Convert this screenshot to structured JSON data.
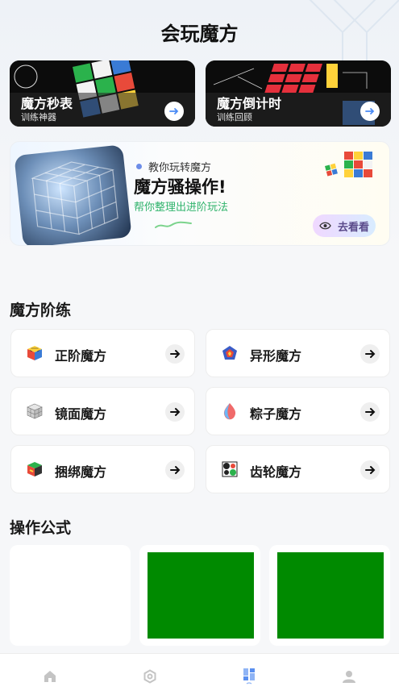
{
  "header": {
    "title": "会玩魔方"
  },
  "top_cards": [
    {
      "title": "魔方秒表",
      "subtitle": "训练神器",
      "icon": "arrow-right-icon"
    },
    {
      "title": "魔方倒计时",
      "subtitle": "训练回顾",
      "icon": "arrow-right-icon"
    }
  ],
  "banner": {
    "tag": "教你玩转魔方",
    "title": "魔方骚操作!",
    "subtitle": "帮你整理出进阶玩法",
    "button_label": "去看看",
    "button_icon": "eye-icon"
  },
  "categories_section": {
    "title": "魔方阶练",
    "items": [
      {
        "label": "正阶魔方",
        "icon": "rubiks-cube-icon"
      },
      {
        "label": "异形魔方",
        "icon": "megaminx-icon"
      },
      {
        "label": "镜面魔方",
        "icon": "mirror-cube-icon"
      },
      {
        "label": "粽子魔方",
        "icon": "pyraminx-icon"
      },
      {
        "label": "捆绑魔方",
        "icon": "bandaged-cube-icon"
      },
      {
        "label": "齿轮魔方",
        "icon": "gear-cube-icon"
      }
    ]
  },
  "formula_section": {
    "title": "操作公式"
  },
  "tabbar": {
    "items": [
      {
        "name": "home",
        "icon": "home-icon"
      },
      {
        "name": "settings",
        "icon": "gear-icon"
      },
      {
        "name": "apps",
        "icon": "grid-icon",
        "active": true
      },
      {
        "name": "profile",
        "icon": "user-icon"
      }
    ]
  },
  "colors": {
    "accent": "#4a8bf5",
    "green": "#2fb36b",
    "formula_green": "#008a00"
  }
}
